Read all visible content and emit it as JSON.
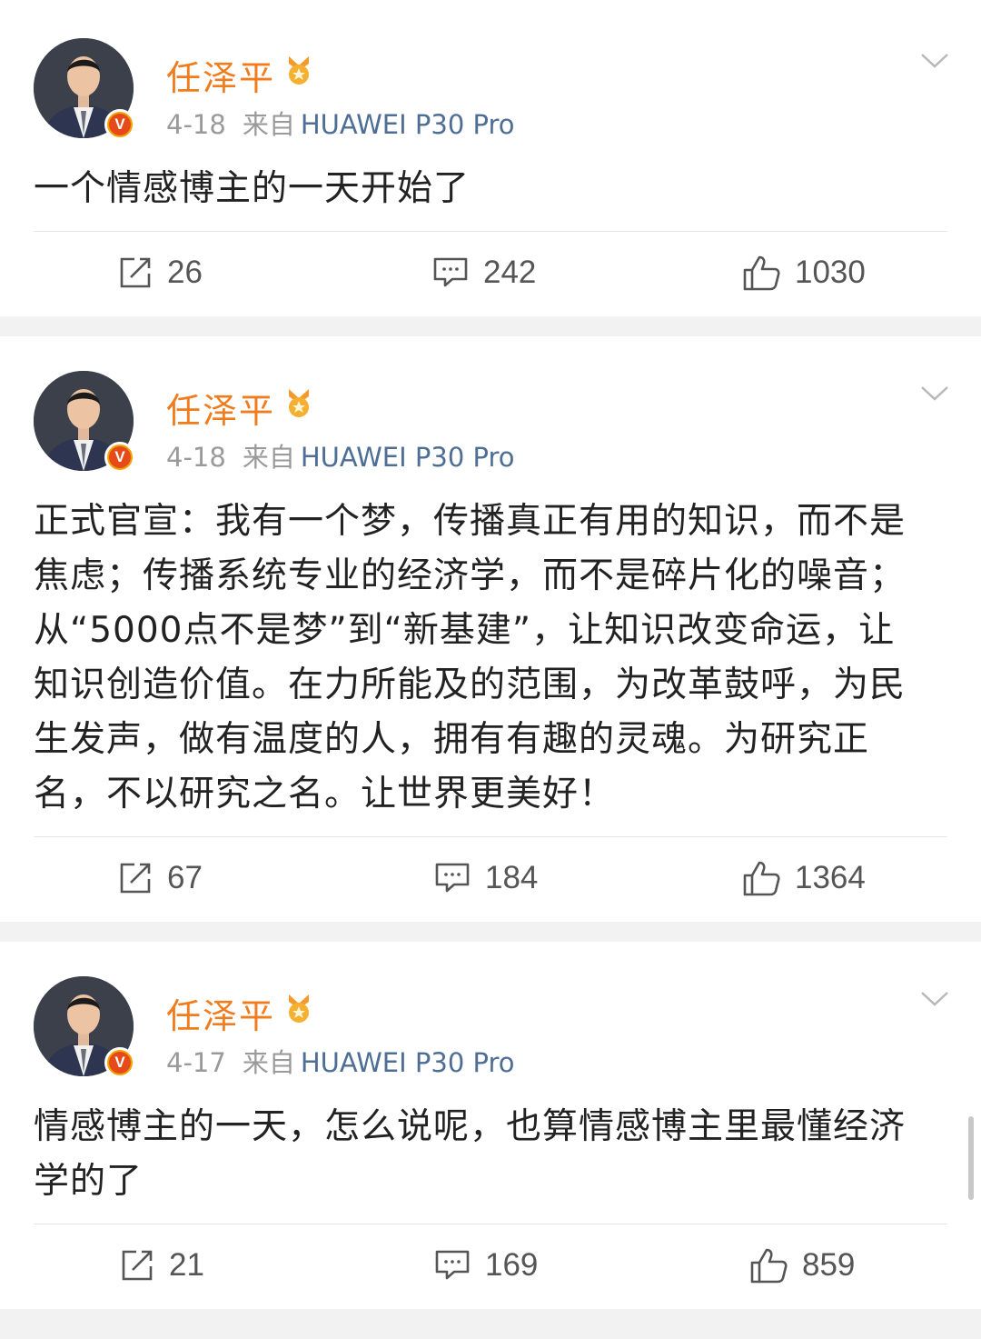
{
  "posts": [
    {
      "author": "任泽平",
      "date": "4-18",
      "source_label": "来自",
      "device": "HUAWEI P30 Pro",
      "content": "一个情感博主的一天开始了",
      "reposts": "26",
      "comments": "242",
      "likes": "1030"
    },
    {
      "author": "任泽平",
      "date": "4-18",
      "source_label": "来自",
      "device": "HUAWEI P30 Pro",
      "content": "正式官宣：我有一个梦，传播真正有用的知识，而不是焦虑；传播系统专业的经济学，而不是碎片化的噪音；从“5000点不是梦”到“新基建”，让知识改变命运，让知识创造价值。在力所能及的范围，为改革鼓呼，为民生发声，做有温度的人，拥有有趣的灵魂。为研究正名，不以研究之名。让世界更美好！",
      "reposts": "67",
      "comments": "184",
      "likes": "1364"
    },
    {
      "author": "任泽平",
      "date": "4-17",
      "source_label": "来自",
      "device": "HUAWEI P30 Pro",
      "content": "情感博主的一天，怎么说呢，也算情感博主里最懂经济学的了",
      "reposts": "21",
      "comments": "169",
      "likes": "859"
    }
  ],
  "icons": {
    "repost": "repost-icon",
    "comment": "comment-icon",
    "like": "thumbs-up-icon",
    "more": "chevron-down-icon",
    "verified": "verified-v-badge-icon",
    "medal": "medal-icon"
  },
  "colors": {
    "author_name": "#f07c1e",
    "device_link": "#4e6e96",
    "meta_text": "#9a9a9a",
    "verified_badge": "#e64a19",
    "page_background": "#f2f2f2"
  }
}
